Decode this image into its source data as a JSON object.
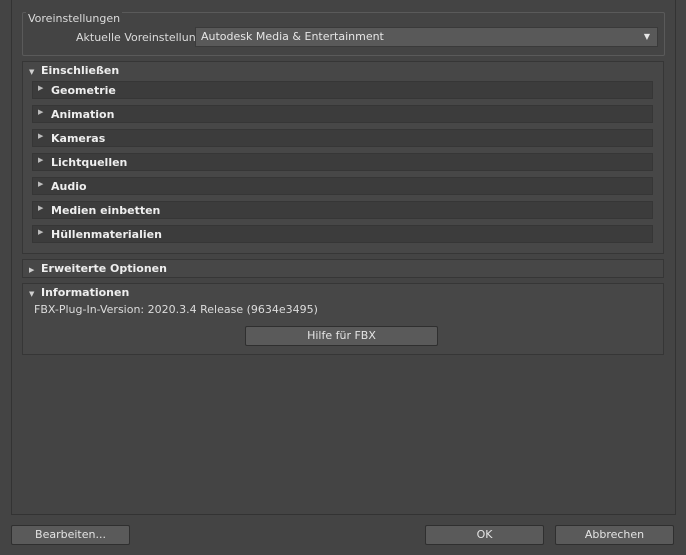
{
  "presets": {
    "group_title": "Voreinstellungen",
    "current_label": "Aktuelle Voreinstellung:",
    "current_value": "Autodesk Media & Entertainment"
  },
  "include": {
    "title": "Einschließen",
    "items": [
      {
        "label": "Geometrie"
      },
      {
        "label": "Animation"
      },
      {
        "label": "Kameras"
      },
      {
        "label": "Lichtquellen"
      },
      {
        "label": "Audio"
      },
      {
        "label": "Medien einbetten"
      },
      {
        "label": "Hüllenmaterialien"
      }
    ]
  },
  "advanced": {
    "title": "Erweiterte Optionen"
  },
  "info": {
    "title": "Informationen",
    "version_text": "FBX-Plug-In-Version: 2020.3.4 Release (9634e3495)",
    "help_button": "Hilfe für FBX"
  },
  "footer": {
    "edit_button": "Bearbeiten...",
    "ok_button": "OK",
    "cancel_button": "Abbrechen"
  }
}
